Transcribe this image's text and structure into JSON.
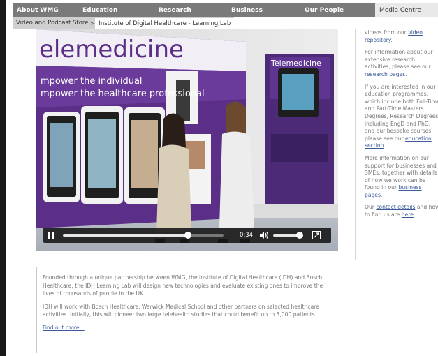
{
  "nav": {
    "items": [
      "About WMG",
      "Education",
      "Research",
      "Business",
      "Our People",
      "Media Centre"
    ],
    "active": "Media Centre"
  },
  "breadcrumb": {
    "parent": "Video and Podcast Store",
    "separator": "»",
    "current": "Institute of Digital Healthcare - Learning Lab"
  },
  "video": {
    "banner_title": "elemedicine",
    "banner_line1": "mpower the individual",
    "banner_line2": "mpower the healthcare professional",
    "panel_title": "Telemedicine",
    "time": "0:34",
    "progress": 0.78,
    "volume": 0.9
  },
  "description": {
    "para1": "Founded through a unique partnership between WMG, the Institute of Digital Healthcare (IDH) and Bosch Healthcare, the IDH Learning Lab will design new technologies and evaluate existing ones to improve the lives of thousands of people in the UK.",
    "para2": "IDH will work with Bosch Healthcare, Warwick Medical School and other partners on selected healthcare activities. Initially, this will pioneer two large telehealth studies that could benefit up to 3,000 patients.",
    "link": "Find out more..."
  },
  "sidebar": {
    "s1_l1_pre": "videos from our ",
    "s1_l1_link": "video",
    "s1_l2_link": "repository",
    "s1_l2_post": ".",
    "s2_l1": "For information about our",
    "s2_l2": "extensive research",
    "s2_l3": "activities, please see our",
    "s2_l4_link": "research pages",
    "s2_l4_post": ".",
    "s3_l1": "If you are interested in our",
    "s3_l2": "education programmes,",
    "s3_l3": "which include both Full-Time",
    "s3_l4": "and Part-Time Masters",
    "s3_l5": "Degrees, Research Degrees",
    "s3_l6": "including EngD and PhD,",
    "s3_l7": "and our bespoke courses,",
    "s3_l8_pre": "please see our ",
    "s3_l8_link": "education",
    "s3_l9_link": "section",
    "s3_l9_post": ".",
    "s4_l1": "More information on our",
    "s4_l2": "support for businesses and",
    "s4_l3": "SMEs, together with details",
    "s4_l4": "of how we work can be",
    "s4_l5_pre": "found in our ",
    "s4_l5_link": "business",
    "s4_l6_link": "pages",
    "s4_l6_post": ".",
    "s5_l1_pre": "Our ",
    "s5_l1_link": "contact details",
    "s5_l1_post": " and how",
    "s5_l2_pre": "to find us are ",
    "s5_l2_link": "here",
    "s5_l2_post": "."
  }
}
